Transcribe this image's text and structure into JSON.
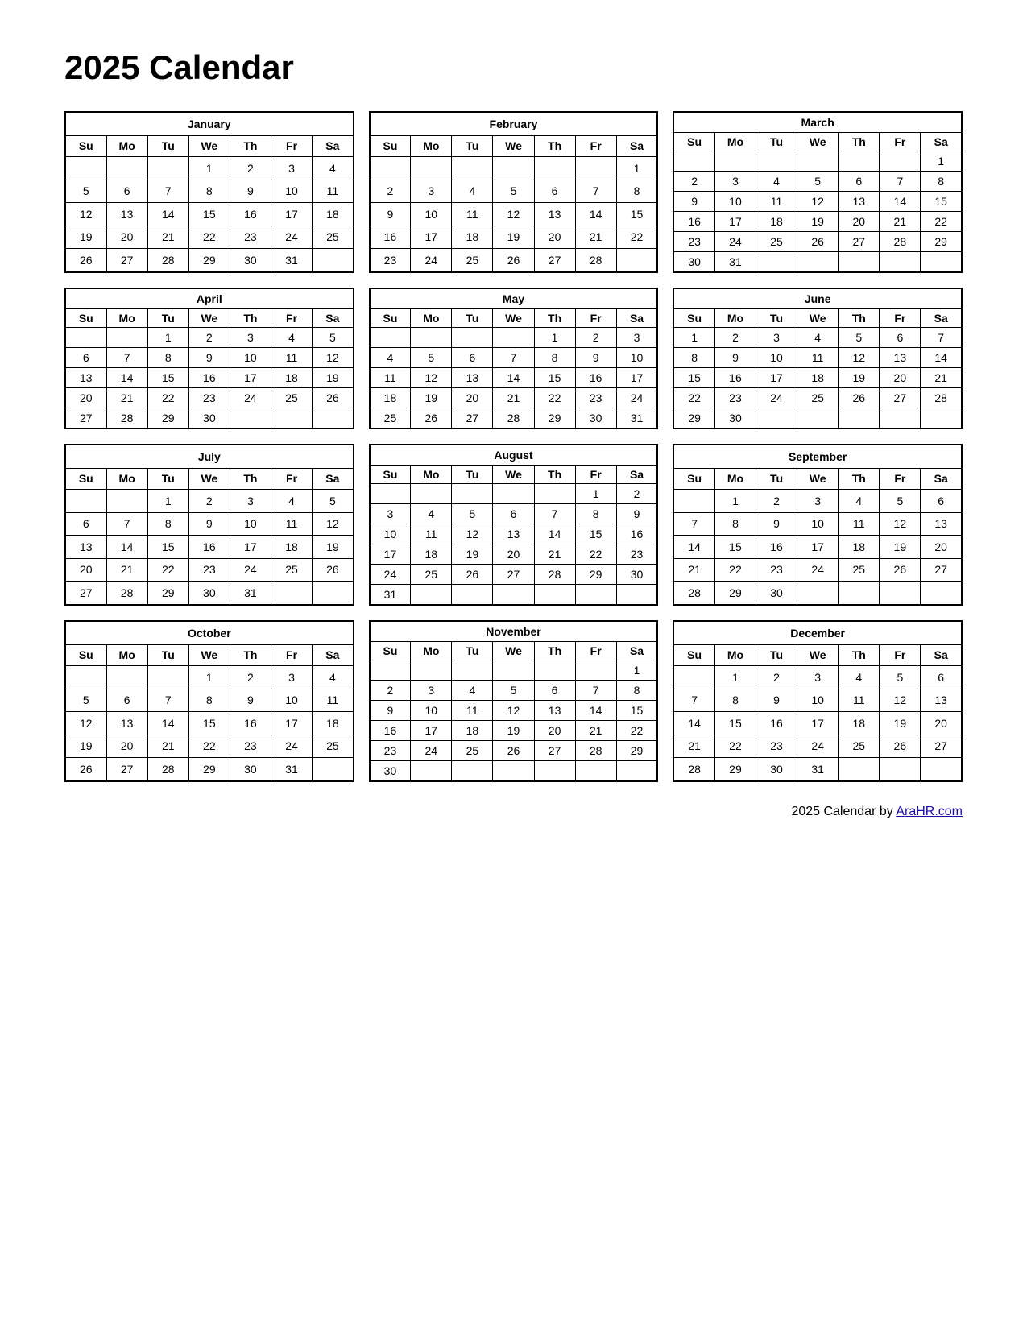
{
  "title": "2025 Calendar",
  "footer": {
    "text": "2025  Calendar by ",
    "link_text": "AraHR.com",
    "link_url": "AraHR.com"
  },
  "days_header": [
    "Su",
    "Mo",
    "Tu",
    "We",
    "Th",
    "Fr",
    "Sa"
  ],
  "months": [
    {
      "name": "January",
      "weeks": [
        [
          "",
          "",
          "",
          "1",
          "2",
          "3",
          "4"
        ],
        [
          "5",
          "6",
          "7",
          "8",
          "9",
          "10",
          "11"
        ],
        [
          "12",
          "13",
          "14",
          "15",
          "16",
          "17",
          "18"
        ],
        [
          "19",
          "20",
          "21",
          "22",
          "23",
          "24",
          "25"
        ],
        [
          "26",
          "27",
          "28",
          "29",
          "30",
          "31",
          ""
        ]
      ]
    },
    {
      "name": "February",
      "weeks": [
        [
          "",
          "",
          "",
          "",
          "",
          "",
          "1"
        ],
        [
          "2",
          "3",
          "4",
          "5",
          "6",
          "7",
          "8"
        ],
        [
          "9",
          "10",
          "11",
          "12",
          "13",
          "14",
          "15"
        ],
        [
          "16",
          "17",
          "18",
          "19",
          "20",
          "21",
          "22"
        ],
        [
          "23",
          "24",
          "25",
          "26",
          "27",
          "28",
          ""
        ]
      ]
    },
    {
      "name": "March",
      "weeks": [
        [
          "",
          "",
          "",
          "",
          "",
          "",
          "1"
        ],
        [
          "2",
          "3",
          "4",
          "5",
          "6",
          "7",
          "8"
        ],
        [
          "9",
          "10",
          "11",
          "12",
          "13",
          "14",
          "15"
        ],
        [
          "16",
          "17",
          "18",
          "19",
          "20",
          "21",
          "22"
        ],
        [
          "23",
          "24",
          "25",
          "26",
          "27",
          "28",
          "29"
        ],
        [
          "30",
          "31",
          "",
          "",
          "",
          "",
          ""
        ]
      ]
    },
    {
      "name": "April",
      "weeks": [
        [
          "",
          "",
          "1",
          "2",
          "3",
          "4",
          "5"
        ],
        [
          "6",
          "7",
          "8",
          "9",
          "10",
          "11",
          "12"
        ],
        [
          "13",
          "14",
          "15",
          "16",
          "17",
          "18",
          "19"
        ],
        [
          "20",
          "21",
          "22",
          "23",
          "24",
          "25",
          "26"
        ],
        [
          "27",
          "28",
          "29",
          "30",
          "",
          "",
          ""
        ]
      ]
    },
    {
      "name": "May",
      "weeks": [
        [
          "",
          "",
          "",
          "",
          "1",
          "2",
          "3"
        ],
        [
          "4",
          "5",
          "6",
          "7",
          "8",
          "9",
          "10"
        ],
        [
          "11",
          "12",
          "13",
          "14",
          "15",
          "16",
          "17"
        ],
        [
          "18",
          "19",
          "20",
          "21",
          "22",
          "23",
          "24"
        ],
        [
          "25",
          "26",
          "27",
          "28",
          "29",
          "30",
          "31"
        ]
      ]
    },
    {
      "name": "June",
      "weeks": [
        [
          "1",
          "2",
          "3",
          "4",
          "5",
          "6",
          "7"
        ],
        [
          "8",
          "9",
          "10",
          "11",
          "12",
          "13",
          "14"
        ],
        [
          "15",
          "16",
          "17",
          "18",
          "19",
          "20",
          "21"
        ],
        [
          "22",
          "23",
          "24",
          "25",
          "26",
          "27",
          "28"
        ],
        [
          "29",
          "30",
          "",
          "",
          "",
          "",
          ""
        ]
      ]
    },
    {
      "name": "July",
      "weeks": [
        [
          "",
          "",
          "1",
          "2",
          "3",
          "4",
          "5"
        ],
        [
          "6",
          "7",
          "8",
          "9",
          "10",
          "11",
          "12"
        ],
        [
          "13",
          "14",
          "15",
          "16",
          "17",
          "18",
          "19"
        ],
        [
          "20",
          "21",
          "22",
          "23",
          "24",
          "25",
          "26"
        ],
        [
          "27",
          "28",
          "29",
          "30",
          "31",
          "",
          ""
        ]
      ]
    },
    {
      "name": "August",
      "weeks": [
        [
          "",
          "",
          "",
          "",
          "",
          "1",
          "2"
        ],
        [
          "3",
          "4",
          "5",
          "6",
          "7",
          "8",
          "9"
        ],
        [
          "10",
          "11",
          "12",
          "13",
          "14",
          "15",
          "16"
        ],
        [
          "17",
          "18",
          "19",
          "20",
          "21",
          "22",
          "23"
        ],
        [
          "24",
          "25",
          "26",
          "27",
          "28",
          "29",
          "30"
        ],
        [
          "31",
          "",
          "",
          "",
          "",
          "",
          ""
        ]
      ]
    },
    {
      "name": "September",
      "weeks": [
        [
          "",
          "1",
          "2",
          "3",
          "4",
          "5",
          "6"
        ],
        [
          "7",
          "8",
          "9",
          "10",
          "11",
          "12",
          "13"
        ],
        [
          "14",
          "15",
          "16",
          "17",
          "18",
          "19",
          "20"
        ],
        [
          "21",
          "22",
          "23",
          "24",
          "25",
          "26",
          "27"
        ],
        [
          "28",
          "29",
          "30",
          "",
          "",
          "",
          ""
        ]
      ]
    },
    {
      "name": "October",
      "weeks": [
        [
          "",
          "",
          "",
          "1",
          "2",
          "3",
          "4"
        ],
        [
          "5",
          "6",
          "7",
          "8",
          "9",
          "10",
          "11"
        ],
        [
          "12",
          "13",
          "14",
          "15",
          "16",
          "17",
          "18"
        ],
        [
          "19",
          "20",
          "21",
          "22",
          "23",
          "24",
          "25"
        ],
        [
          "26",
          "27",
          "28",
          "29",
          "30",
          "31",
          ""
        ]
      ]
    },
    {
      "name": "November",
      "weeks": [
        [
          "",
          "",
          "",
          "",
          "",
          "",
          "1"
        ],
        [
          "2",
          "3",
          "4",
          "5",
          "6",
          "7",
          "8"
        ],
        [
          "9",
          "10",
          "11",
          "12",
          "13",
          "14",
          "15"
        ],
        [
          "16",
          "17",
          "18",
          "19",
          "20",
          "21",
          "22"
        ],
        [
          "23",
          "24",
          "25",
          "26",
          "27",
          "28",
          "29"
        ],
        [
          "30",
          "",
          "",
          "",
          "",
          "",
          ""
        ]
      ]
    },
    {
      "name": "December",
      "weeks": [
        [
          "",
          "1",
          "2",
          "3",
          "4",
          "5",
          "6"
        ],
        [
          "7",
          "8",
          "9",
          "10",
          "11",
          "12",
          "13"
        ],
        [
          "14",
          "15",
          "16",
          "17",
          "18",
          "19",
          "20"
        ],
        [
          "21",
          "22",
          "23",
          "24",
          "25",
          "26",
          "27"
        ],
        [
          "28",
          "29",
          "30",
          "31",
          "",
          "",
          ""
        ]
      ]
    }
  ]
}
